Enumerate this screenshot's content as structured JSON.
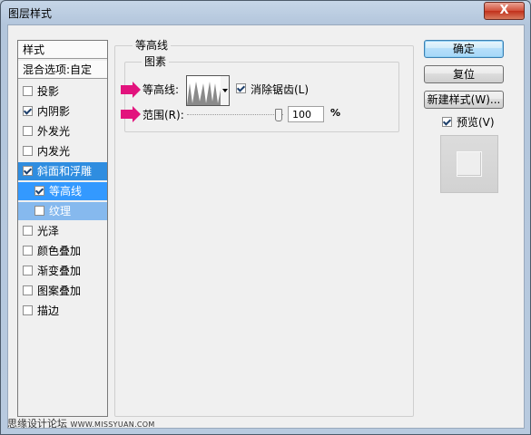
{
  "window": {
    "title": "图层样式",
    "close_label": "X"
  },
  "styles_list": {
    "header": "样式",
    "blend_options": "混合选项:自定",
    "items": [
      {
        "label": "投影",
        "checked": false
      },
      {
        "label": "内阴影",
        "checked": true
      },
      {
        "label": "外发光",
        "checked": false
      },
      {
        "label": "内发光",
        "checked": false
      },
      {
        "label": "斜面和浮雕",
        "checked": true
      },
      {
        "label": "等高线",
        "checked": true
      },
      {
        "label": "纹理",
        "checked": false
      },
      {
        "label": "光泽",
        "checked": false
      },
      {
        "label": "颜色叠加",
        "checked": false
      },
      {
        "label": "渐变叠加",
        "checked": false
      },
      {
        "label": "图案叠加",
        "checked": false
      },
      {
        "label": "描边",
        "checked": false
      }
    ]
  },
  "contour_panel": {
    "section_title": "等高线",
    "group_title": "图素",
    "contour_label": "等高线:",
    "anti_alias_label": "消除锯齿(L)",
    "anti_alias_checked": true,
    "range_label": "范围(R):",
    "range_value": "100",
    "range_unit": "%",
    "range_percent": 100
  },
  "buttons": {
    "ok": "确定",
    "reset": "复位",
    "new_style": "新建样式(W)...",
    "preview_label": "预览(V)",
    "preview_checked": true
  },
  "watermark": {
    "text": "思缘设计论坛",
    "url": "WWW.MISSYUAN.COM"
  },
  "colors": {
    "selection": "#2f8de0",
    "sub_selection": "#3399ff",
    "annotation_arrow": "#e2137d"
  }
}
